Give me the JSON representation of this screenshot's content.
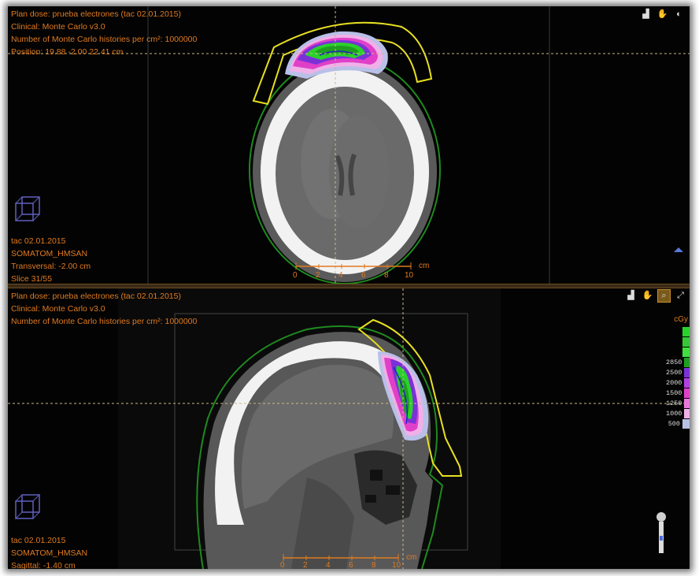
{
  "top_view": {
    "plan_line": "Plan dose: prueba electrones (tac 02.01.2015)",
    "clinical_line": "Clinical: Monte Carlo v3.0",
    "histories_line": "Number of Monte Carlo histories per cm²: 1000000",
    "position_line": "Position: 19.88 -2.00 22.41 cm",
    "study_line": "tac 02.01.2015",
    "scanner_line": "SOMATOM_HMSAN",
    "orientation_line": "Transversal: -2.00 cm",
    "slice_line": "Slice 31/55",
    "scale_ticks": [
      "0",
      "2",
      "4",
      "6",
      "8",
      "10"
    ],
    "scale_unit": "cm",
    "toolbar": {
      "icons": [
        "dose-histogram-icon",
        "pan-hand-icon",
        "window-level-icon"
      ]
    }
  },
  "bottom_view": {
    "plan_line": "Plan dose: prueba electrones (tac 02.01.2015)",
    "clinical_line": "Clinical: Monte Carlo v3.0",
    "histories_line": "Number of Monte Carlo histories per cm²: 1000000",
    "study_line": "tac 02.01.2015",
    "scanner_line": "SOMATOM_HMSAN",
    "orientation_line": "Sagittal: -1.40 cm",
    "scale_ticks": [
      "0",
      "2",
      "4",
      "6",
      "8",
      "10"
    ],
    "scale_unit": "cm",
    "toolbar": {
      "icons": [
        "dose-histogram-icon",
        "pan-hand-icon",
        "zoom-icon",
        "fullscreen-icon"
      ]
    }
  },
  "dose_legend": {
    "unit": "cGy",
    "levels": [
      {
        "value": "",
        "color": "#2bd12b"
      },
      {
        "value": "",
        "color": "#37c837"
      },
      {
        "value": "",
        "color": "#3fe03f"
      },
      {
        "value": "2850",
        "color": "#1f9f1f"
      },
      {
        "value": "2500",
        "color": "#7a32d8"
      },
      {
        "value": "2000",
        "color": "#b040e0"
      },
      {
        "value": "1500",
        "color": "#e040c8"
      },
      {
        "value": "1250",
        "color": "#e878d8"
      },
      {
        "value": "1000",
        "color": "#f0b0e8"
      },
      {
        "value": "500",
        "color": "#b8c0e8"
      }
    ]
  },
  "colors": {
    "overlay_text": "#e07a1f",
    "body_contour": "#1f8a1f",
    "bolus_contour": "#e8e020",
    "crosshair": "#c9b98a"
  }
}
